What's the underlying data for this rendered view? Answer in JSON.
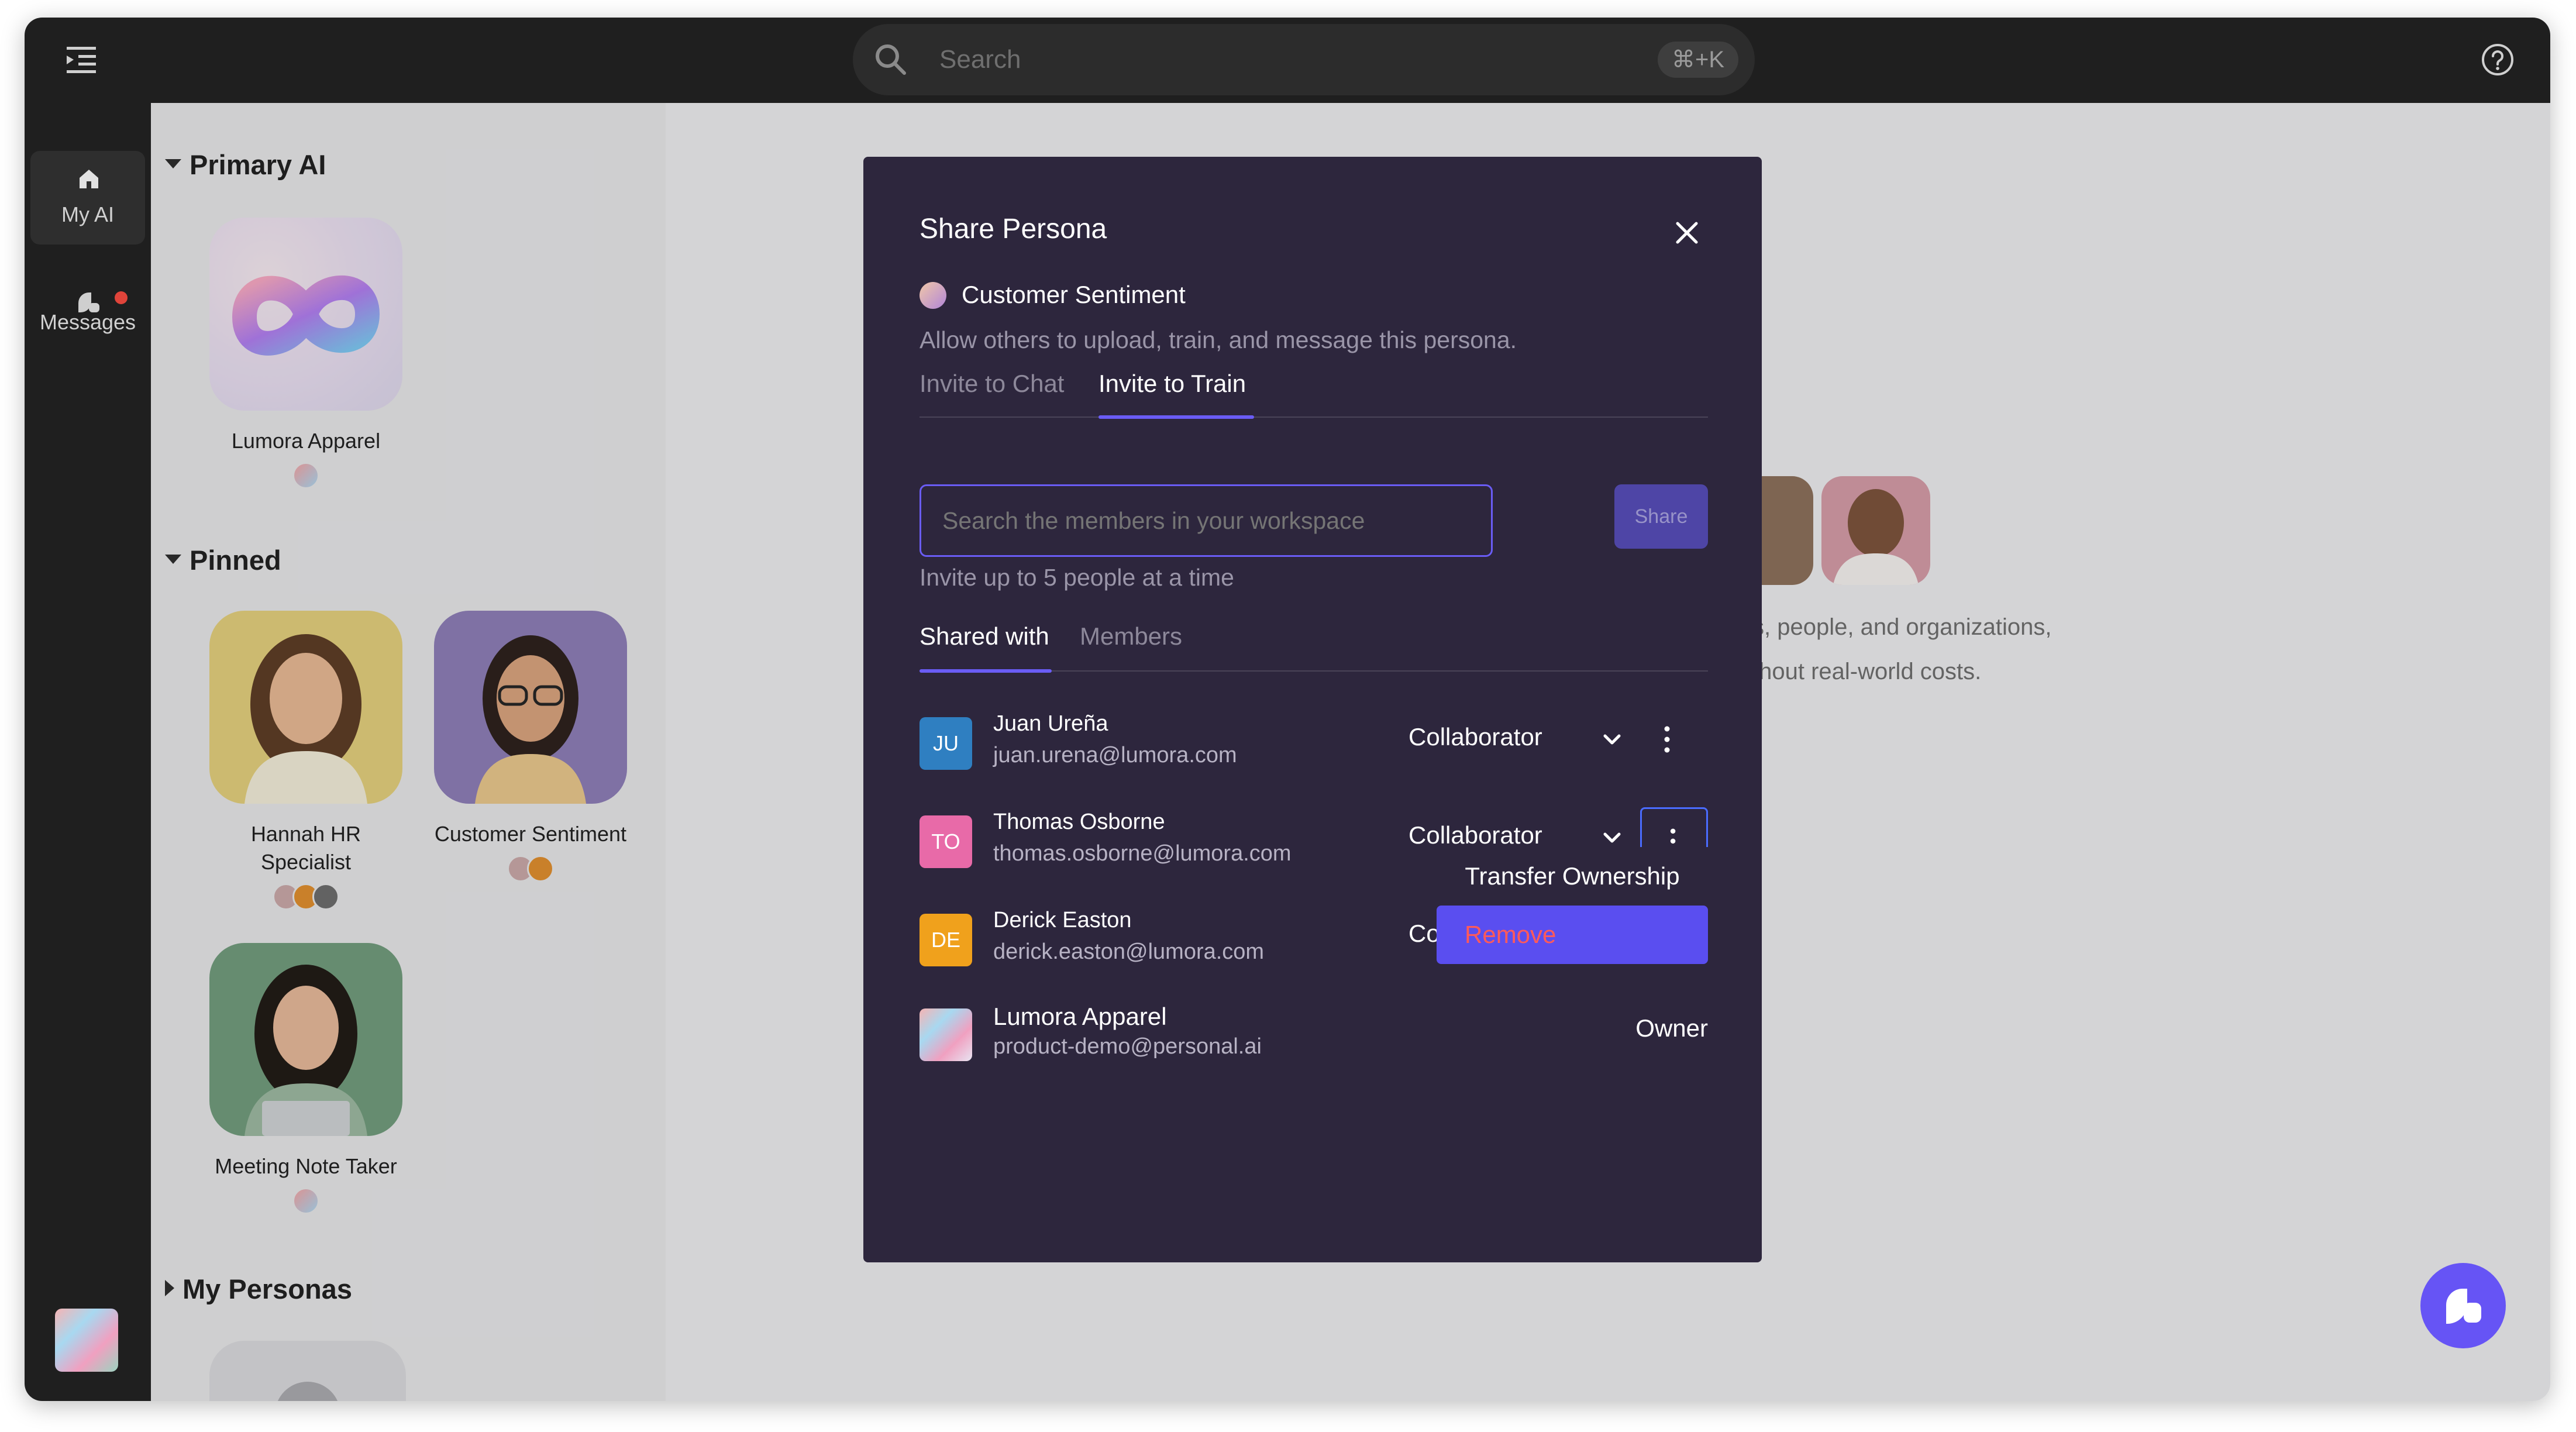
{
  "topbar": {
    "search_placeholder": "Search",
    "shortcut": "⌘+K"
  },
  "rail": {
    "items": [
      {
        "label": "My AI"
      },
      {
        "label": "Messages"
      }
    ]
  },
  "sidebar": {
    "sections": [
      {
        "title": "Primary AI"
      },
      {
        "title": "Pinned"
      },
      {
        "title": "My Personas"
      }
    ],
    "primary": {
      "name": "Lumora Apparel"
    },
    "pinned": [
      {
        "name": "Hannah HR Specialist"
      },
      {
        "name": "Customer Sentiment"
      },
      {
        "name": "Meeting Note Taker"
      }
    ]
  },
  "background": {
    "line1": "s, people, and organizations,",
    "line2": "thout real-world costs."
  },
  "modal": {
    "title": "Share Persona",
    "persona_name": "Customer Sentiment",
    "subtitle": "Allow others to upload, train, and message this persona.",
    "tabs": [
      "Invite to Chat",
      "Invite to Train"
    ],
    "search_placeholder": "Search the members in your workspace",
    "share_label": "Share",
    "hint": "Invite up to 5 people at a time",
    "subtabs": [
      "Shared with",
      "Members"
    ],
    "members": [
      {
        "initials": "JU",
        "name": "Juan Ureña",
        "email": "juan.urena@lumora.com",
        "role": "Collaborator",
        "color": "#2f7fc1"
      },
      {
        "initials": "TO",
        "name": "Thomas Osborne",
        "email": "thomas.osborne@lumora.com",
        "role": "Collaborator",
        "color": "#e86aa8"
      },
      {
        "initials": "DE",
        "name": "Derick Easton",
        "email": "derick.easton@lumora.com",
        "role": "Co",
        "color": "#f0a11c"
      },
      {
        "initials": "",
        "name": "Lumora Apparel",
        "email": "product-demo@personal.ai",
        "role": "Owner",
        "color": "#cccccc"
      }
    ],
    "menu": {
      "transfer": "Transfer Ownership",
      "remove": "Remove"
    }
  },
  "colors": {
    "accent": "#6a5cf5",
    "modal_bg": "#2d263d",
    "danger": "#ff5a5a"
  }
}
